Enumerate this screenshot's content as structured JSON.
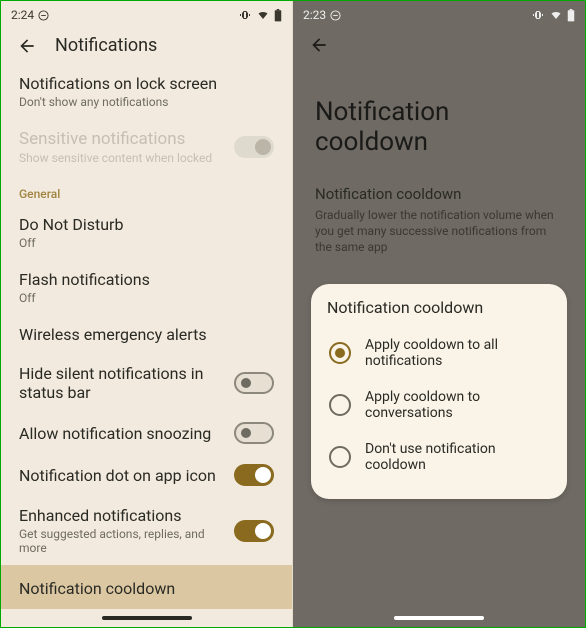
{
  "left": {
    "status": {
      "time": "2:24"
    },
    "header": {
      "title": "Notifications"
    },
    "items": [
      {
        "primary": "Notifications on lock screen",
        "secondary": "Don't show any notifications",
        "toggle": null
      },
      {
        "primary": "Sensitive notifications",
        "secondary": "Show sensitive content when locked",
        "toggle": "disabled",
        "disabled": true
      },
      {
        "section": "General"
      },
      {
        "primary": "Do Not Disturb",
        "secondary": "Off",
        "toggle": null
      },
      {
        "primary": "Flash notifications",
        "secondary": "Off",
        "toggle": null
      },
      {
        "primary": "Wireless emergency alerts",
        "secondary": "",
        "toggle": null
      },
      {
        "primary": "Hide silent notifications in status bar",
        "secondary": "",
        "toggle": "off"
      },
      {
        "primary": "Allow notification snoozing",
        "secondary": "",
        "toggle": "off"
      },
      {
        "primary": "Notification dot on app icon",
        "secondary": "",
        "toggle": "on"
      },
      {
        "primary": "Enhanced notifications",
        "secondary": "Get suggested actions, replies, and more",
        "toggle": "on"
      },
      {
        "primary": "Notification cooldown",
        "secondary": "",
        "toggle": null,
        "highlighted": true
      }
    ]
  },
  "right": {
    "status": {
      "time": "2:23"
    },
    "title": "Notification cooldown",
    "subtitle": "Notification cooldown",
    "desc": "Gradually lower the notification volume when you get many successive notifications from the same app",
    "popup": {
      "title": "Notification cooldown",
      "options": [
        {
          "label": "Apply cooldown to all notifications",
          "selected": true
        },
        {
          "label": "Apply cooldown to conversations",
          "selected": false
        },
        {
          "label": "Don't use notification cooldown",
          "selected": false
        }
      ]
    }
  }
}
